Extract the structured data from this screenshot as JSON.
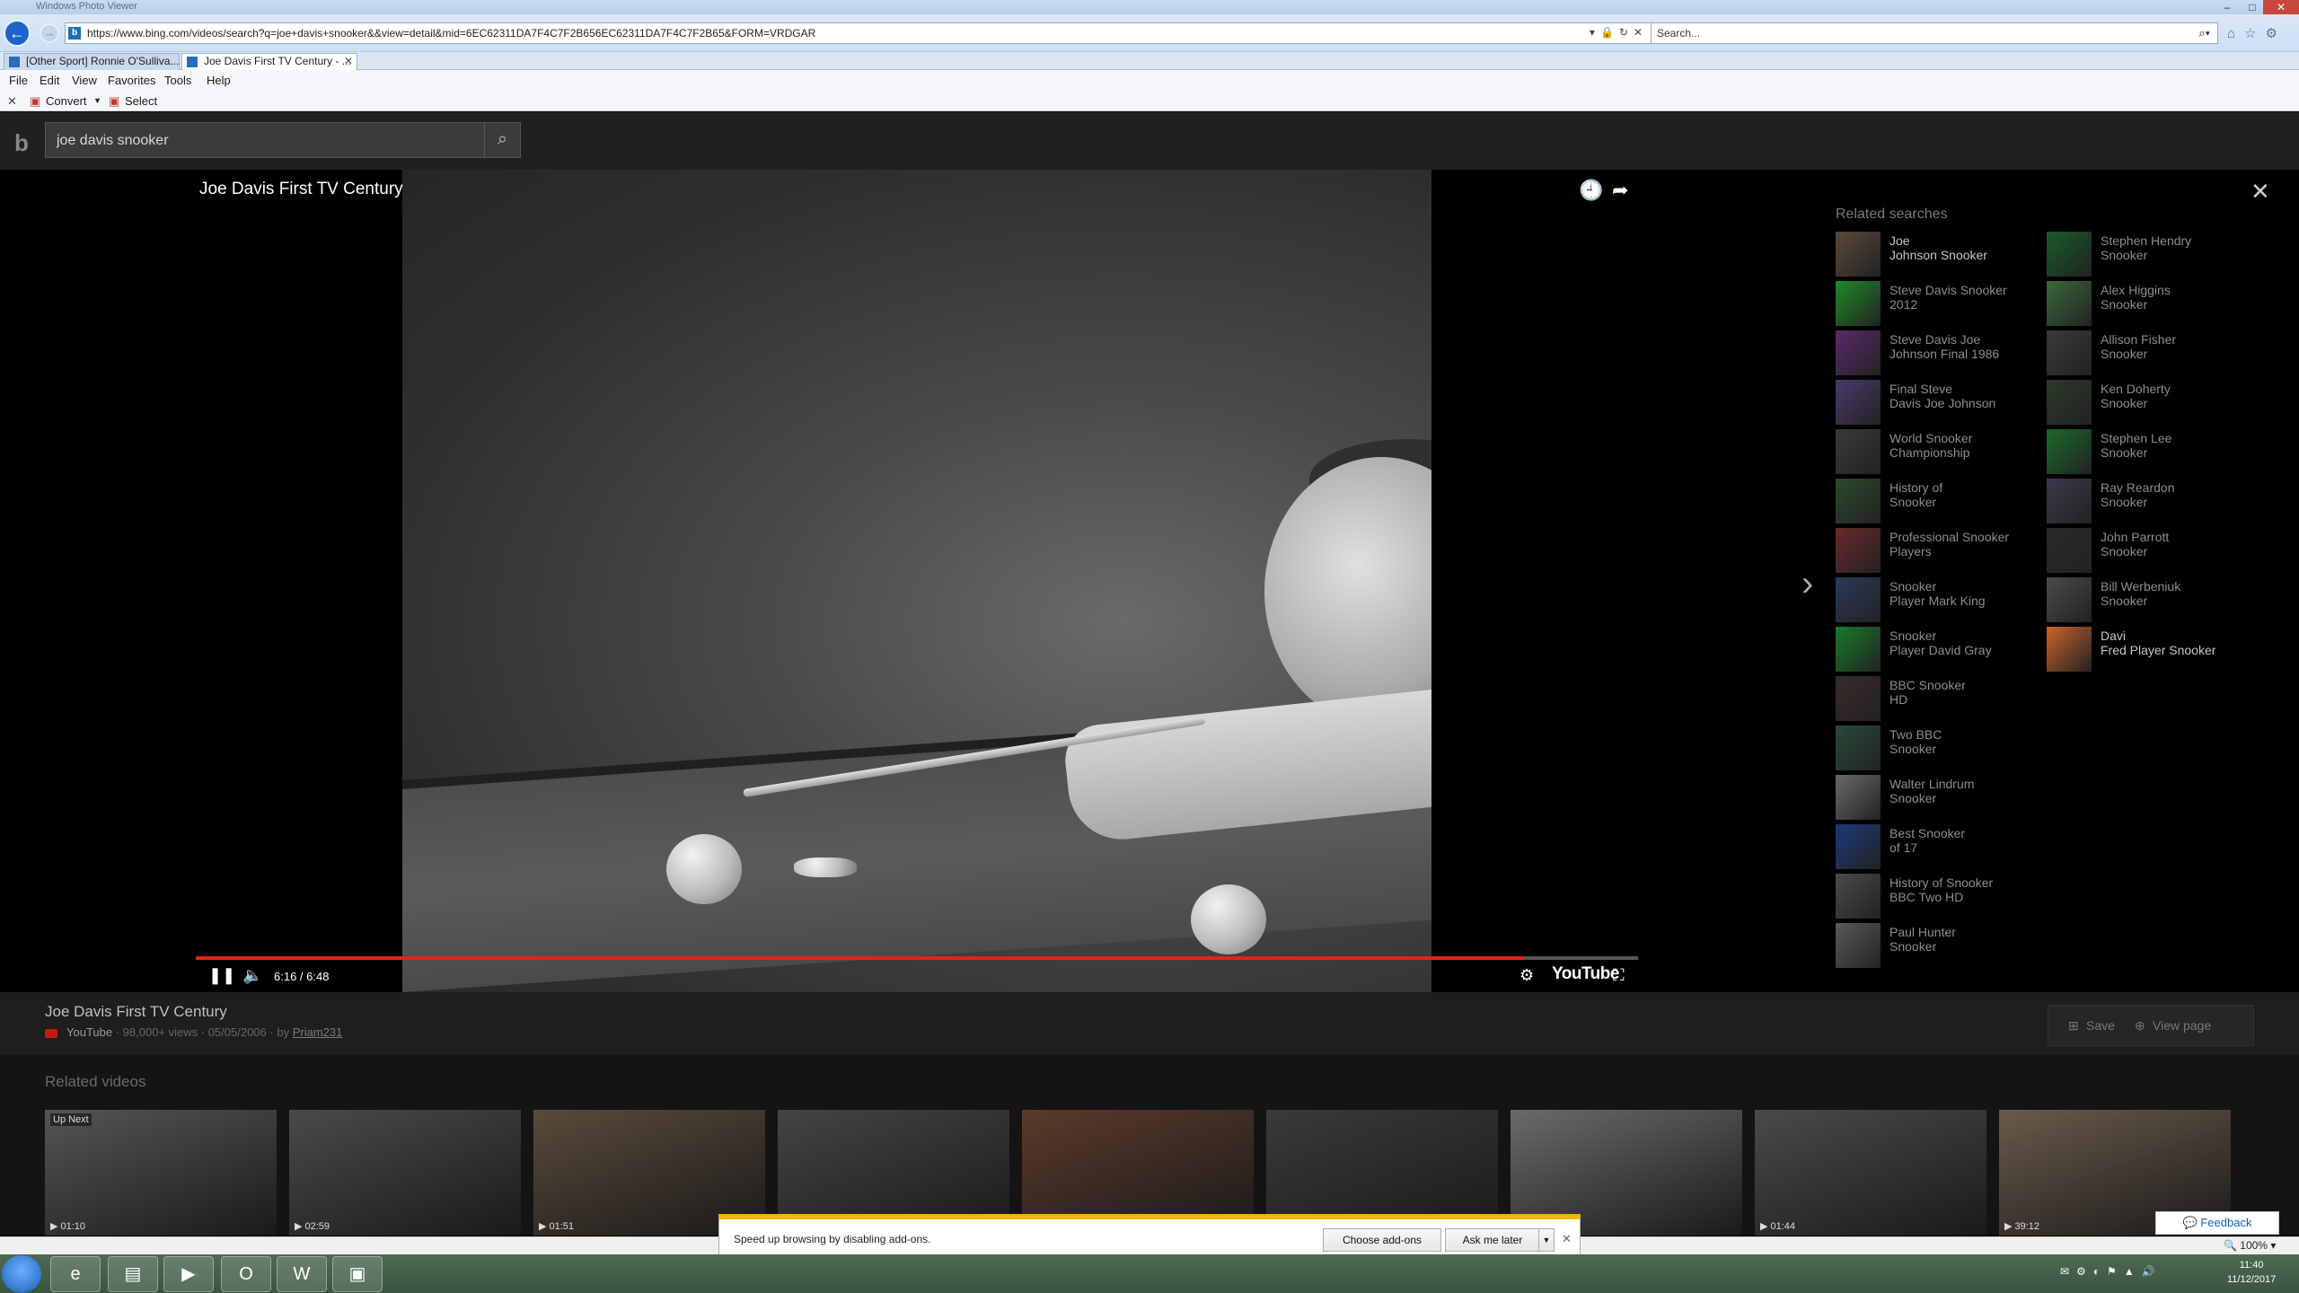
{
  "browser": {
    "window_title": "Windows Photo Viewer",
    "url": "https://www.bing.com/videos/search?q=joe+davis+snooker&&view=detail&mid=6EC62311DA7F4C7F2B656EC62311DA7F4C7F2B65&FORM=VRDGAR",
    "search_placeholder": "Search...",
    "tabs": [
      {
        "label": "[Other Sport] Ronnie O'Sulliva..."
      },
      {
        "label": "Joe Davis First TV Century - ..."
      }
    ],
    "menu": [
      "File",
      "Edit",
      "View",
      "Favorites",
      "Tools",
      "Help"
    ],
    "commands": {
      "convert": "Convert",
      "select": "Select"
    }
  },
  "bing": {
    "query": "joe davis snooker",
    "logo": "b"
  },
  "video": {
    "title": "Joe Davis First TV Century",
    "time": "6:16 / 6:48",
    "progress": 0.92,
    "brand": "YouTube"
  },
  "related_searches": {
    "title": "Related searches",
    "col1": [
      {
        "l1": "Joe",
        "l2": "Johnson Snooker",
        "bold": true,
        "color": "#5a4a3a"
      },
      {
        "l1": "Steve Davis Snooker",
        "l2": "2012",
        "bold": false,
        "color": "#1f8a2a"
      },
      {
        "l1": "Steve Davis Joe",
        "l2": "Johnson Final 1986",
        "bold": false,
        "color": "#5a2a6a"
      },
      {
        "l1": "Final Steve",
        "l2": "Davis Joe Johnson",
        "bold": false,
        "color": "#4a3a6a"
      },
      {
        "l1": "World Snooker",
        "l2": "Championship",
        "bold": false,
        "color": "#3a3a3a"
      },
      {
        "l1": "History of",
        "l2": "Snooker",
        "bold": false,
        "color": "#2a4a2a"
      },
      {
        "l1": "Professional Snooker",
        "l2": "Players",
        "bold": false,
        "color": "#6a2a2a"
      },
      {
        "l1": "Snooker",
        "l2": "Player Mark King",
        "bold": false,
        "color": "#2a3a5a"
      },
      {
        "l1": "Snooker",
        "l2": "Player David Gray",
        "bold": false,
        "color": "#1a7a2a"
      },
      {
        "l1": "BBC Snooker",
        "l2": "HD",
        "bold": false,
        "color": "#3a2a2a"
      },
      {
        "l1": "Two BBC",
        "l2": "Snooker",
        "bold": false,
        "color": "#2a4a3a"
      },
      {
        "l1": "Walter Lindrum",
        "l2": "Snooker",
        "bold": false,
        "color": "#6a6a6a"
      },
      {
        "l1": "Best Snooker",
        "l2": "of 17",
        "bold": false,
        "color": "#1a3a7a"
      },
      {
        "l1": "History of Snooker",
        "l2": "BBC Two HD",
        "bold": false,
        "color": "#4a4a4a"
      },
      {
        "l1": "Paul Hunter",
        "l2": "Snooker",
        "bold": false,
        "color": "#5a5a5a"
      }
    ],
    "col2": [
      {
        "l1": "Stephen Hendry",
        "l2": "Snooker",
        "bold": false,
        "color": "#1a5a2a"
      },
      {
        "l1": "Alex Higgins",
        "l2": "Snooker",
        "bold": false,
        "color": "#3a6a3a"
      },
      {
        "l1": "Allison Fisher",
        "l2": "Snooker",
        "bold": false,
        "color": "#3a3a3a"
      },
      {
        "l1": "Ken Doherty",
        "l2": "Snooker",
        "bold": false,
        "color": "#2a3a2a"
      },
      {
        "l1": "Stephen Lee",
        "l2": "Snooker",
        "bold": false,
        "color": "#1a6a2a"
      },
      {
        "l1": "Ray Reardon",
        "l2": "Snooker",
        "bold": false,
        "color": "#3a3a4a"
      },
      {
        "l1": "John Parrott",
        "l2": "Snooker",
        "bold": false,
        "color": "#2a2a2a"
      },
      {
        "l1": "Bill Werbeniuk",
        "l2": "Snooker",
        "bold": false,
        "color": "#4a4a4a"
      },
      {
        "l1": "Davi",
        "l2": "Fred Player Snooker",
        "bold": true,
        "color": "#c8642a"
      }
    ]
  },
  "info": {
    "title": "Joe Davis First TV Century",
    "source": "YouTube",
    "views": "98,000+ views",
    "date": "05/05/2006",
    "by": "by",
    "author": "Priam231",
    "save": "Save",
    "view_page": "View page"
  },
  "related_videos": {
    "title": "Related videos",
    "items": [
      {
        "duration": "01:10",
        "badge": "Up Next",
        "color": "#555"
      },
      {
        "duration": "02:59",
        "badge": "",
        "color": "#4a4a4a"
      },
      {
        "duration": "01:51",
        "badge": "",
        "color": "#5a4a3a"
      },
      {
        "duration": "",
        "badge": "",
        "color": "#444"
      },
      {
        "duration": "",
        "badge": "",
        "color": "#5a3a2a"
      },
      {
        "duration": "",
        "badge": "",
        "color": "#3a3a3a"
      },
      {
        "duration": "",
        "badge": "",
        "color": "#6a6a6a"
      },
      {
        "duration": "01:44",
        "badge": "",
        "color": "#4a4a4a"
      },
      {
        "duration": "39:12",
        "badge": "",
        "color": "#6a5a4a"
      }
    ]
  },
  "notification": {
    "message": "Speed up browsing by disabling add-ons.",
    "choose": "Choose add-ons",
    "later": "Ask me later"
  },
  "feedback": "Feedback",
  "zoom": "100%",
  "clock": {
    "time": "11:40",
    "date": "11/12/2017"
  }
}
